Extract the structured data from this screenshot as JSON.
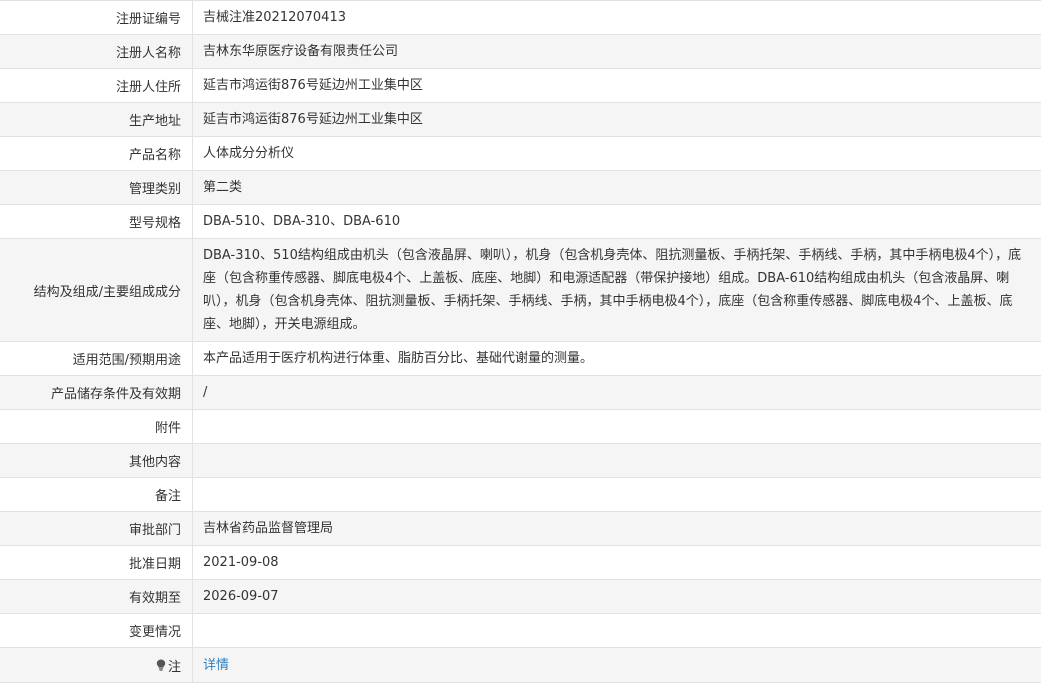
{
  "rows": [
    {
      "label": "注册证编号",
      "value": "吉械注准20212070413"
    },
    {
      "label": "注册人名称",
      "value": "吉林东华原医疗设备有限责任公司"
    },
    {
      "label": "注册人住所",
      "value": "延吉市鸿运街876号延边州工业集中区"
    },
    {
      "label": "生产地址",
      "value": "延吉市鸿运街876号延边州工业集中区"
    },
    {
      "label": "产品名称",
      "value": "人体成分分析仪"
    },
    {
      "label": "管理类别",
      "value": "第二类"
    },
    {
      "label": "型号规格",
      "value": "DBA-510、DBA-310、DBA-610"
    },
    {
      "label": "结构及组成/主要组成成分",
      "value": "DBA-310、510结构组成由机头（包含液晶屏、喇叭），机身（包含机身壳体、阻抗测量板、手柄托架、手柄线、手柄，其中手柄电极4个），底座（包含称重传感器、脚底电极4个、上盖板、底座、地脚）和电源适配器（带保护接地）组成。DBA-610结构组成由机头（包含液晶屏、喇叭），机身（包含机身壳体、阻抗测量板、手柄托架、手柄线、手柄，其中手柄电极4个），底座（包含称重传感器、脚底电极4个、上盖板、底座、地脚），开关电源组成。"
    },
    {
      "label": "适用范围/预期用途",
      "value": "本产品适用于医疗机构进行体重、脂肪百分比、基础代谢量的测量。"
    },
    {
      "label": "产品储存条件及有效期",
      "value": "/"
    },
    {
      "label": "附件",
      "value": ""
    },
    {
      "label": "其他内容",
      "value": ""
    },
    {
      "label": "备注",
      "value": ""
    },
    {
      "label": "审批部门",
      "value": "吉林省药品监督管理局"
    },
    {
      "label": "批准日期",
      "value": "2021-09-08"
    },
    {
      "label": "有效期至",
      "value": "2026-09-07"
    },
    {
      "label": "变更情况",
      "value": ""
    }
  ],
  "note_row": {
    "label": "注",
    "link_text": "详情",
    "icon": "lightbulb-icon"
  },
  "colors": {
    "border": "#e2e2e2",
    "alt_bg": "#f5f5f5",
    "link": "#2f7fc1",
    "text": "#333333"
  }
}
